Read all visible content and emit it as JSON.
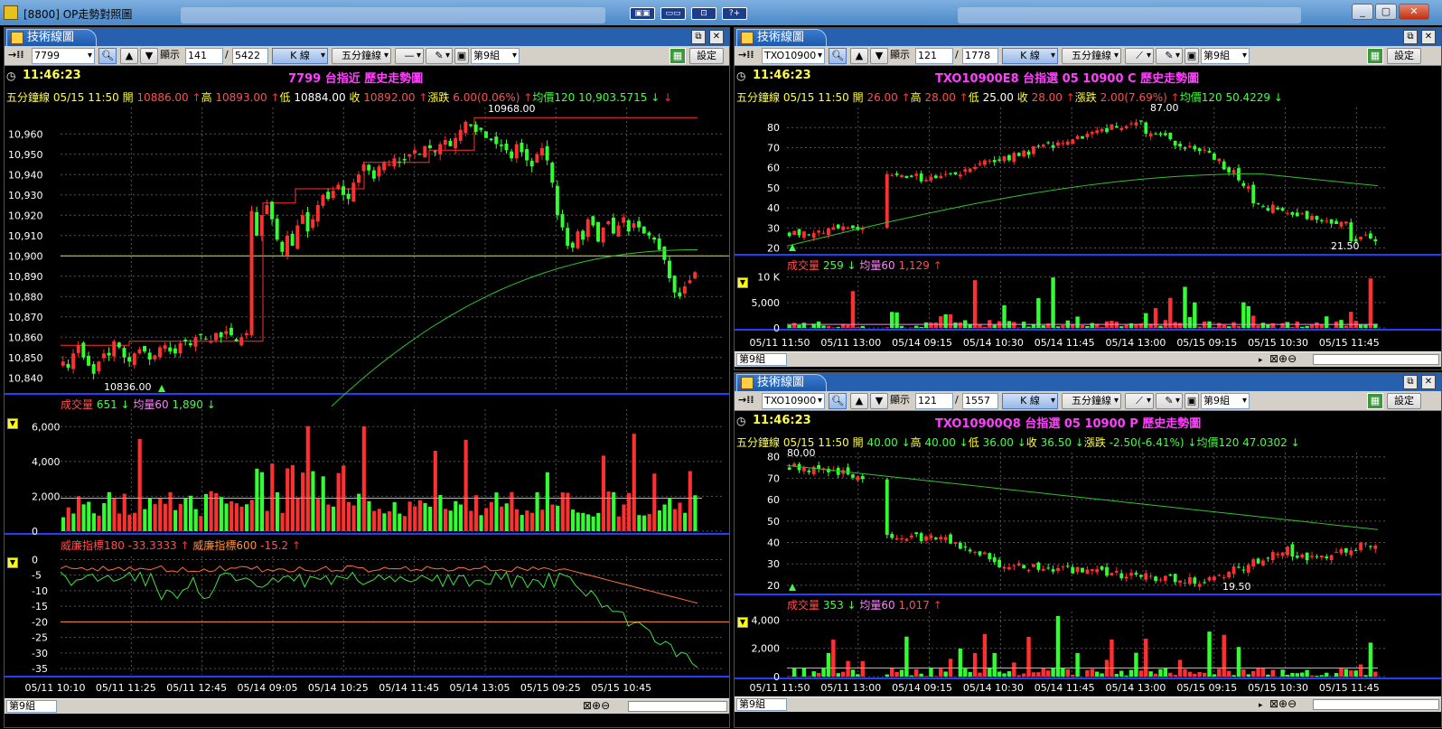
{
  "window": {
    "title": "[8800] OP走勢對照圖",
    "buttons": [
      "▣▣",
      "▭▭",
      "⊡",
      "?+"
    ]
  },
  "tab_title": "技術線圖",
  "toolbar": {
    "display_label": "顯示",
    "kline": "K 線",
    "period": "五分鐘線",
    "group": "第9組",
    "settings": "設定"
  },
  "panels": {
    "left": {
      "code": "7799",
      "count": "141",
      "total": "5422",
      "time": "11:46:23",
      "name": "7799 台指近 歷史走勢圖",
      "ohlc": [
        {
          "t": "五分鐘線 05/15 11:50",
          "c": "#ffff40"
        },
        {
          "t": " 開 ",
          "c": "#ffff40"
        },
        {
          "t": "10886.00",
          "c": "#ff5050"
        },
        {
          "t": " ↑",
          "c": "#ff3030"
        },
        {
          "t": "高 ",
          "c": "#ffff40"
        },
        {
          "t": "10893.00",
          "c": "#ff5050"
        },
        {
          "t": " ↑",
          "c": "#ff3030"
        },
        {
          "t": "低 ",
          "c": "#ffff40"
        },
        {
          "t": "10884.00",
          "c": "#ffffff"
        },
        {
          "t": "  收 ",
          "c": "#ffff40"
        },
        {
          "t": "10892.00",
          "c": "#ff5050"
        },
        {
          "t": " ↑",
          "c": "#ff3030"
        },
        {
          "t": "漲跌 ",
          "c": "#ffff40"
        },
        {
          "t": "6.00(0.06%)",
          "c": "#ff5050"
        },
        {
          "t": " ↑",
          "c": "#ff3030"
        },
        {
          "t": "均價120 ",
          "c": "#40ff40"
        },
        {
          "t": "10,903.5715",
          "c": "#40ff40"
        },
        {
          "t": "  ↓",
          "c": "#40ff40"
        },
        {
          "t": "  ↓",
          "c": "#ff3030"
        }
      ],
      "vol_line": [
        {
          "t": "成交量 ",
          "c": "#ff5050"
        },
        {
          "t": "651",
          "c": "#40ff40"
        },
        {
          "t": " ↓ ",
          "c": "#40ff40"
        },
        {
          "t": "均量60 ",
          "c": "#ff80ff"
        },
        {
          "t": "1,890",
          "c": "#40ff40"
        },
        {
          "t": " ↓",
          "c": "#40ff40"
        }
      ],
      "wr_line": [
        {
          "t": "威廉指標180 ",
          "c": "#ff5050"
        },
        {
          "t": "-33.3333",
          "c": "#ff5050"
        },
        {
          "t": " ↑ ",
          "c": "#ff3030"
        },
        {
          "t": "威廉指標600 ",
          "c": "#ff9040"
        },
        {
          "t": "-15.2",
          "c": "#ff5050"
        },
        {
          "t": " ↑",
          "c": "#ff3030"
        }
      ],
      "status": "第9組"
    },
    "rtop": {
      "code": "TXO10900",
      "count": "121",
      "total": "1778",
      "time": "11:46:23",
      "name": "TXO10900E8 台指選 05 10900 C 歷史走勢圖",
      "ohlc": [
        {
          "t": "五分鐘線 05/15 11:50",
          "c": "#ffff40"
        },
        {
          "t": " 開 ",
          "c": "#ffff40"
        },
        {
          "t": "26.00",
          "c": "#ff5050"
        },
        {
          "t": " ↑",
          "c": "#ff3030"
        },
        {
          "t": "高 ",
          "c": "#ffff40"
        },
        {
          "t": "28.00",
          "c": "#ff5050"
        },
        {
          "t": " ↑",
          "c": "#ff3030"
        },
        {
          "t": "低 ",
          "c": "#ffff40"
        },
        {
          "t": "25.00",
          "c": "#ffffff"
        },
        {
          "t": "  收 ",
          "c": "#ffff40"
        },
        {
          "t": "28.00",
          "c": "#ff5050"
        },
        {
          "t": " ↑",
          "c": "#ff3030"
        },
        {
          "t": "漲跌 ",
          "c": "#ffff40"
        },
        {
          "t": "2.00(7.69%)",
          "c": "#ff5050"
        },
        {
          "t": " ↑",
          "c": "#ff3030"
        },
        {
          "t": "均價120 ",
          "c": "#40ff40"
        },
        {
          "t": "50.4229",
          "c": "#40ff40"
        },
        {
          "t": " ↓",
          "c": "#40ff40"
        }
      ],
      "vol_line": [
        {
          "t": "成交量 ",
          "c": "#ff5050"
        },
        {
          "t": "259",
          "c": "#40ff40"
        },
        {
          "t": " ↓ ",
          "c": "#40ff40"
        },
        {
          "t": "均量60 ",
          "c": "#ff80ff"
        },
        {
          "t": "1,129",
          "c": "#ff5050"
        },
        {
          "t": " ↑",
          "c": "#ff3030"
        }
      ],
      "status": "第9組"
    },
    "rbot": {
      "code": "TXO10900",
      "count": "121",
      "total": "1557",
      "time": "11:46:23",
      "name": "TXO10900Q8 台指選 05 10900 P 歷史走勢圖",
      "ohlc": [
        {
          "t": "五分鐘線 05/15 11:50",
          "c": "#ffff40"
        },
        {
          "t": " 開 ",
          "c": "#ffff40"
        },
        {
          "t": "40.00",
          "c": "#40ff40"
        },
        {
          "t": " ↓",
          "c": "#40ff40"
        },
        {
          "t": "高 ",
          "c": "#ffff40"
        },
        {
          "t": "40.00",
          "c": "#40ff40"
        },
        {
          "t": " ↓",
          "c": "#40ff40"
        },
        {
          "t": "低 ",
          "c": "#ffff40"
        },
        {
          "t": "36.00",
          "c": "#40ff40"
        },
        {
          "t": " ↓",
          "c": "#40ff40"
        },
        {
          "t": "收 ",
          "c": "#ffff40"
        },
        {
          "t": "36.50",
          "c": "#40ff40"
        },
        {
          "t": " ↓",
          "c": "#40ff40"
        },
        {
          "t": "漲跌 ",
          "c": "#ffff40"
        },
        {
          "t": "-2.50(-6.41%)",
          "c": "#40ff40"
        },
        {
          "t": " ↓",
          "c": "#40ff40"
        },
        {
          "t": "均價120 ",
          "c": "#40ff40"
        },
        {
          "t": "47.0302",
          "c": "#40ff40"
        },
        {
          "t": " ↓",
          "c": "#40ff40"
        }
      ],
      "vol_line": [
        {
          "t": "成交量 ",
          "c": "#ff5050"
        },
        {
          "t": "353",
          "c": "#40ff40"
        },
        {
          "t": " ↓ ",
          "c": "#40ff40"
        },
        {
          "t": "均量60 ",
          "c": "#ff80ff"
        },
        {
          "t": "1,017",
          "c": "#ff5050"
        },
        {
          "t": " ↑",
          "c": "#ff3030"
        }
      ],
      "status": "第9組"
    }
  },
  "chart_data": [
    {
      "id": "left-price",
      "type": "candlestick",
      "ylim": [
        10833,
        10973
      ],
      "yticks": [
        "10,960",
        "10,950",
        "10,940",
        "10,930",
        "10,920",
        "10,910",
        "10,900",
        "10,890",
        "10,880",
        "10,870",
        "10,860",
        "10,850",
        "10,840"
      ],
      "ytick_values": [
        10960,
        10950,
        10940,
        10930,
        10920,
        10910,
        10900,
        10890,
        10880,
        10870,
        10860,
        10850,
        10840
      ],
      "xlabels": [
        "05/11 10:10",
        "05/11 11:25",
        "05/11 12:45",
        "05/14 09:05",
        "05/14 10:25",
        "05/14 11:45",
        "05/14 13:05",
        "05/15 09:25",
        "05/15 10:45"
      ],
      "close": [
        10848,
        10845,
        10852,
        10856,
        10850,
        10846,
        10842,
        10848,
        10852,
        10851,
        10858,
        10855,
        10850,
        10848,
        10852,
        10854,
        10853,
        10849,
        10851,
        10855,
        10856,
        10853,
        10852,
        10857,
        10858,
        10856,
        10860,
        10861,
        10859,
        10858,
        10862,
        10860,
        10863,
        10861,
        10858,
        10860,
        10862,
        10922,
        10910,
        10920,
        10925,
        10918,
        10908,
        10902,
        10910,
        10905,
        10915,
        10920,
        10912,
        10918,
        10925,
        10930,
        10928,
        10932,
        10935,
        10930,
        10928,
        10936,
        10940,
        10945,
        10942,
        10938,
        10944,
        10946,
        10945,
        10948,
        10946,
        10947,
        10950,
        10952,
        10950,
        10954,
        10953,
        10951,
        10955,
        10957,
        10954,
        10958,
        10962,
        10966,
        10964,
        10961,
        10962,
        10958,
        10957,
        10955,
        10954,
        10952,
        10948,
        10955,
        10951,
        10947,
        10944,
        10950,
        10953,
        10947,
        10936,
        10920,
        10914,
        10905,
        10904,
        10912,
        10908,
        10918,
        10915,
        10907,
        10914,
        10917,
        10911,
        10915,
        10919,
        10912,
        10916,
        10914,
        10911,
        10910,
        10908,
        10903,
        10898,
        10889,
        10882,
        10880,
        10885,
        10888,
        10892
      ],
      "annotations": [
        {
          "text": "10968.00",
          "kind": "max"
        },
        {
          "text": "10836.00",
          "kind": "min"
        }
      ],
      "hline": 10900
    },
    {
      "id": "left-volume",
      "type": "bar",
      "ylim": [
        0,
        7000
      ],
      "yticks": [
        "6,000",
        "4,000",
        "2,000",
        "0"
      ],
      "ytick_values": [
        6000,
        4000,
        2000,
        0
      ],
      "seed": 3,
      "count": 125,
      "avg_value": 1890
    },
    {
      "id": "left-williams",
      "type": "line",
      "ylim": [
        -37,
        1
      ],
      "yticks": [
        "0",
        "-5",
        "-10",
        "-15",
        "-20",
        "-25",
        "-30",
        "-35"
      ],
      "ytick_values": [
        0,
        -5,
        -10,
        -15,
        -20,
        -25,
        -30,
        -35
      ],
      "hline": -20
    },
    {
      "id": "rtop-price",
      "type": "candlestick",
      "ylim": [
        18,
        90
      ],
      "yticks": [
        "80",
        "70",
        "60",
        "50",
        "40",
        "30",
        "20"
      ],
      "ytick_values": [
        80,
        70,
        60,
        50,
        40,
        30,
        20
      ],
      "xlabels": [
        "05/11 11:50",
        "05/11 13:00",
        "05/14 09:15",
        "05/14 10:30",
        "05/14 11:45",
        "05/14 13:00",
        "05/15 09:15",
        "05/15 10:30",
        "05/15 11:45"
      ],
      "annotations": [
        {
          "text": "87.00",
          "kind": "max"
        },
        {
          "text": "21.50",
          "kind": "min"
        }
      ]
    },
    {
      "id": "rtop-volume",
      "type": "bar",
      "ylim": [
        0,
        11000
      ],
      "yticks": [
        "10 K",
        "5,000",
        "0"
      ],
      "ytick_values": [
        10000,
        5000,
        0
      ],
      "avg_value": 1129
    },
    {
      "id": "rbot-price",
      "type": "candlestick",
      "ylim": [
        17,
        82
      ],
      "yticks": [
        "80",
        "70",
        "60",
        "50",
        "40",
        "30",
        "20"
      ],
      "ytick_values": [
        80,
        70,
        60,
        50,
        40,
        30,
        20
      ],
      "xlabels": [
        "05/11 11:50",
        "05/11 13:00",
        "05/14 09:15",
        "05/14 10:30",
        "05/14 11:45",
        "05/14 13:00",
        "05/15 09:15",
        "05/15 10:30",
        "05/15 11:45"
      ],
      "annotations": [
        {
          "text": "80.00",
          "kind": "max"
        },
        {
          "text": "19.50",
          "kind": "min"
        }
      ]
    },
    {
      "id": "rbot-volume",
      "type": "bar",
      "ylim": [
        0,
        4600
      ],
      "yticks": [
        "4,000",
        "2,000",
        "0"
      ],
      "ytick_values": [
        4000,
        2000,
        0
      ],
      "avg_value": 1017
    }
  ]
}
